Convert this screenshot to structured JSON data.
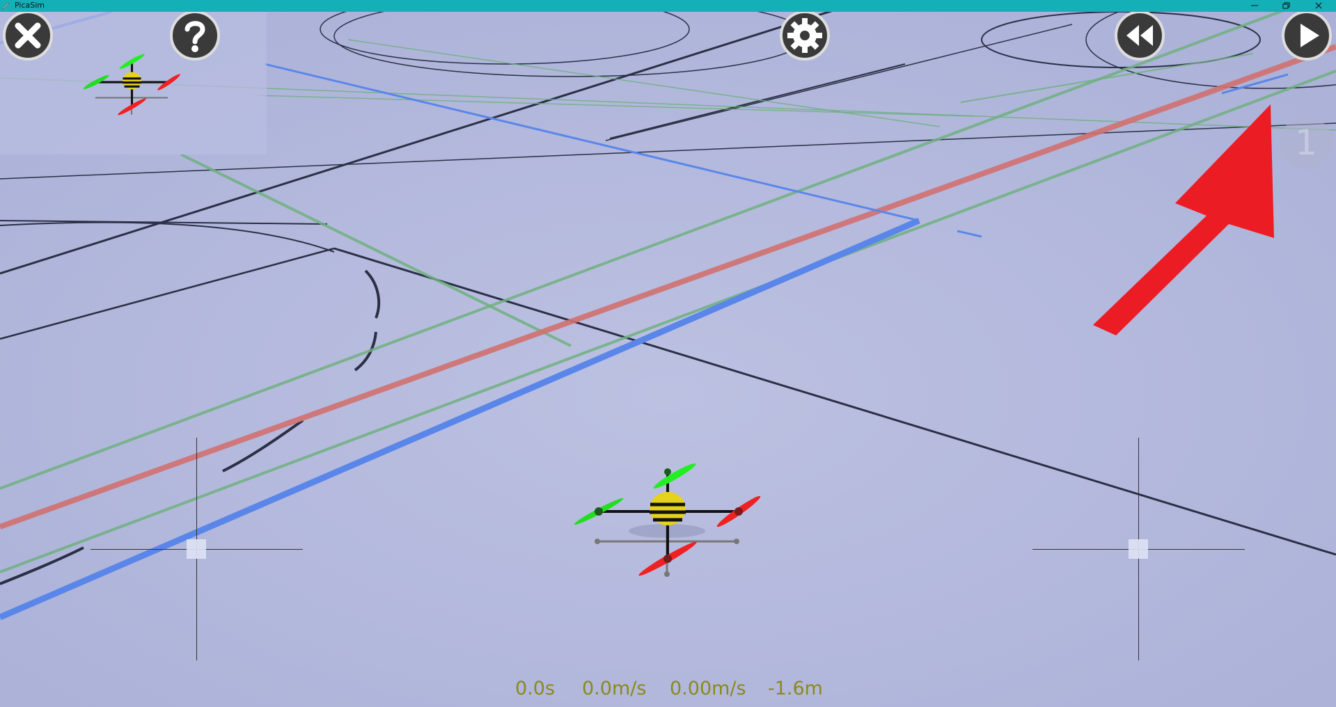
{
  "window": {
    "title": "PicaSim",
    "controls": [
      "minimize-icon",
      "restore-icon",
      "close-icon"
    ]
  },
  "toolbar": {
    "buttons": [
      {
        "name": "close-button",
        "icon": "close-x-icon"
      },
      {
        "name": "help-button",
        "icon": "question-mark-icon"
      },
      {
        "name": "settings-button",
        "icon": "gear-icon"
      },
      {
        "name": "rewind-button",
        "icon": "rewind-icon"
      },
      {
        "name": "play-button",
        "icon": "play-icon"
      }
    ]
  },
  "overlay": {
    "badge_label": "1",
    "arrow_color": "#ec1c24"
  },
  "status": {
    "time": "0.0s",
    "speed": "0.0m/s",
    "vertical_speed": "0.00m/s",
    "altitude": "-1.6m",
    "color": "#8a8a1a"
  },
  "colors": {
    "titlebar": "#13b0b8",
    "floor": "#b2b7dc",
    "line_red": "#d2706f",
    "line_blue": "#5a86ea",
    "line_green": "#6fb07e",
    "line_dark": "#2a2f45"
  }
}
